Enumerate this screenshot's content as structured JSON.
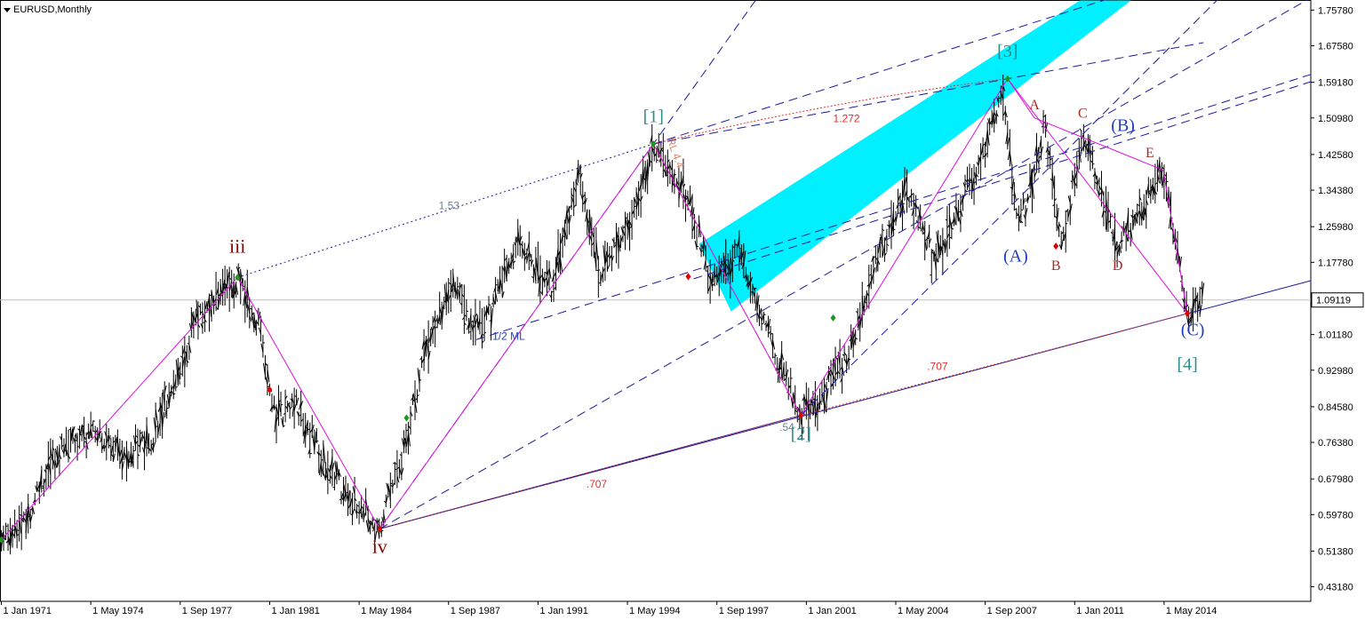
{
  "header": {
    "symbol_label": "EURUSD,Monthly"
  },
  "chart_data": {
    "type": "bar",
    "symbol": "EURUSD",
    "timeframe": "Monthly",
    "ylim": [
      0.3983,
      1.781
    ],
    "y_ticks": [
      "1.75780",
      "1.67580",
      "1.59180",
      "1.50980",
      "1.42580",
      "1.34380",
      "1.25980",
      "1.17780",
      "1.09119",
      "1.01180",
      "0.92980",
      "0.84580",
      "0.76380",
      "0.67980",
      "0.59780",
      "0.51380",
      "0.43180"
    ],
    "current_price": 1.09119,
    "x_ticks": [
      "1 Jan 1971",
      "1 May 1974",
      "1 Sep 1977",
      "1 Jan 1981",
      "1 May 1984",
      "1 Sep 1987",
      "1 Jan 1991",
      "1 May 1994",
      "1 Sep 1997",
      "1 Jan 2001",
      "1 May 2004",
      "1 Sep 2007",
      "1 Jan 2011",
      "1 May 2014"
    ],
    "price_anchors": [
      {
        "t": 1971.0,
        "v": 0.54
      },
      {
        "t": 1972.0,
        "v": 0.6
      },
      {
        "t": 1973.0,
        "v": 0.74
      },
      {
        "t": 1974.5,
        "v": 0.8
      },
      {
        "t": 1975.5,
        "v": 0.74
      },
      {
        "t": 1976.5,
        "v": 0.76
      },
      {
        "t": 1977.5,
        "v": 0.9
      },
      {
        "t": 1978.2,
        "v": 1.04
      },
      {
        "t": 1979.8,
        "v": 1.143
      },
      {
        "t": 1980.6,
        "v": 1.03
      },
      {
        "t": 1981.2,
        "v": 0.82
      },
      {
        "t": 1982.0,
        "v": 0.85
      },
      {
        "t": 1983.0,
        "v": 0.72
      },
      {
        "t": 1984.1,
        "v": 0.62
      },
      {
        "t": 1985.1,
        "v": 0.565
      },
      {
        "t": 1986.0,
        "v": 0.75
      },
      {
        "t": 1987.0,
        "v": 1.02
      },
      {
        "t": 1988.0,
        "v": 1.13
      },
      {
        "t": 1988.6,
        "v": 1.02
      },
      {
        "t": 1989.2,
        "v": 1.06
      },
      {
        "t": 1990.3,
        "v": 1.22
      },
      {
        "t": 1991.5,
        "v": 1.12
      },
      {
        "t": 1992.5,
        "v": 1.38
      },
      {
        "t": 1993.3,
        "v": 1.15
      },
      {
        "t": 1994.5,
        "v": 1.28
      },
      {
        "t": 1995.3,
        "v": 1.45
      },
      {
        "t": 1996.5,
        "v": 1.34
      },
      {
        "t": 1997.5,
        "v": 1.13
      },
      {
        "t": 1998.5,
        "v": 1.2
      },
      {
        "t": 1999.3,
        "v": 1.05
      },
      {
        "t": 2000.3,
        "v": 0.9
      },
      {
        "t": 2000.8,
        "v": 0.826
      },
      {
        "t": 2001.5,
        "v": 0.87
      },
      {
        "t": 2002.5,
        "v": 0.96
      },
      {
        "t": 2003.3,
        "v": 1.13
      },
      {
        "t": 2004.8,
        "v": 1.35
      },
      {
        "t": 2005.8,
        "v": 1.18
      },
      {
        "t": 2006.8,
        "v": 1.31
      },
      {
        "t": 2007.8,
        "v": 1.46
      },
      {
        "t": 2008.3,
        "v": 1.59
      },
      {
        "t": 2008.9,
        "v": 1.25
      },
      {
        "t": 2009.9,
        "v": 1.5
      },
      {
        "t": 2010.5,
        "v": 1.2
      },
      {
        "t": 2011.3,
        "v": 1.48
      },
      {
        "t": 2012.6,
        "v": 1.21
      },
      {
        "t": 2013.5,
        "v": 1.3
      },
      {
        "t": 2014.3,
        "v": 1.39
      },
      {
        "t": 2015.2,
        "v": 1.06
      },
      {
        "t": 2015.8,
        "v": 1.1
      }
    ],
    "wave_points": [
      {
        "t": 1971.0,
        "v": 0.54
      },
      {
        "t": 1979.8,
        "v": 1.143
      },
      {
        "t": 1985.1,
        "v": 0.565
      },
      {
        "t": 1995.3,
        "v": 1.45
      },
      {
        "t": 2000.8,
        "v": 0.826
      },
      {
        "t": 2008.5,
        "v": 1.6
      },
      {
        "t": 2015.2,
        "v": 1.06
      }
    ],
    "correction_points": [
      {
        "t": 2008.5,
        "v": 1.6
      },
      {
        "t": 2009.5,
        "v": 1.51
      },
      {
        "t": 2014.3,
        "v": 1.39
      },
      {
        "t": 2015.2,
        "v": 1.06
      }
    ],
    "wave_labels": [
      {
        "text": "iii",
        "t": 1979.8,
        "v": 1.2,
        "color": "#8b0000",
        "size": 22
      },
      {
        "text": "iv",
        "t": 1985.1,
        "v": 0.51,
        "color": "#8b0000",
        "size": 22
      },
      {
        "text": "[1]",
        "t": 1995.3,
        "v": 1.5,
        "color": "#2e8b8b",
        "size": 20
      },
      {
        "text": "[2]",
        "t": 2000.8,
        "v": 0.77,
        "color": "#2e8b8b",
        "size": 20
      },
      {
        "text": "[3]",
        "t": 2008.5,
        "v": 1.65,
        "color": "#2e8b8b",
        "size": 20
      },
      {
        "text": "[4]",
        "t": 2015.2,
        "v": 0.93,
        "color": "#2e8b8b",
        "size": 20
      },
      {
        "text": "(A)",
        "t": 2008.8,
        "v": 1.18,
        "color": "#1f3fbf",
        "size": 20
      },
      {
        "text": "(B)",
        "t": 2012.8,
        "v": 1.48,
        "color": "#1f3fbf",
        "size": 20
      },
      {
        "text": "(C)",
        "t": 2015.4,
        "v": 1.01,
        "color": "#1f3fbf",
        "size": 20
      },
      {
        "text": "A",
        "t": 2009.5,
        "v": 1.53,
        "color": "#a52a2a",
        "size": 16
      },
      {
        "text": "B",
        "t": 2010.3,
        "v": 1.16,
        "color": "#a52a2a",
        "size": 16
      },
      {
        "text": "C",
        "t": 2011.3,
        "v": 1.51,
        "color": "#a52a2a",
        "size": 16
      },
      {
        "text": "D",
        "t": 2012.6,
        "v": 1.16,
        "color": "#a52a2a",
        "size": 16
      },
      {
        "text": "E",
        "t": 2013.8,
        "v": 1.42,
        "color": "#a52a2a",
        "size": 16
      }
    ],
    "annotations": [
      {
        "text": "1.53",
        "t": 1987.3,
        "v": 1.3,
        "color": "#708090"
      },
      {
        "text": "1.272",
        "t": 2002.0,
        "v": 1.5,
        "color": "#e03030"
      },
      {
        "text": "1/2 ML",
        "t": 1989.3,
        "v": 1.0,
        "color": "#1f3fbf"
      },
      {
        "text": ".707",
        "t": 1992.8,
        "v": 0.66,
        "color": "#e03030"
      },
      {
        "text": ".707",
        "t": 2005.5,
        "v": 0.93,
        "color": "#e03030"
      },
      {
        "text": ".54",
        "t": 2000.0,
        "v": 0.79,
        "color": "#708090"
      },
      {
        "text": "RL 4.4",
        "t": 1995.8,
        "v": 1.46,
        "color": "#e08060"
      }
    ],
    "fractal_points": [
      {
        "t": 1971.0,
        "v": 0.54,
        "color": "#1a9a1a"
      },
      {
        "t": 1979.8,
        "v": 1.143,
        "color": "#1a9a1a"
      },
      {
        "t": 1981.0,
        "v": 0.885,
        "color": "#e00000"
      },
      {
        "t": 1985.1,
        "v": 0.565,
        "color": "#e00000"
      },
      {
        "t": 1986.1,
        "v": 0.82,
        "color": "#1a9a1a"
      },
      {
        "t": 1995.3,
        "v": 1.45,
        "color": "#1a9a1a"
      },
      {
        "t": 1996.6,
        "v": 1.145,
        "color": "#e00000"
      },
      {
        "t": 2000.8,
        "v": 0.826,
        "color": "#e00000"
      },
      {
        "t": 2002.0,
        "v": 1.05,
        "color": "#1a9a1a"
      },
      {
        "t": 2008.5,
        "v": 1.6,
        "color": "#1a9a1a"
      },
      {
        "t": 2010.3,
        "v": 1.215,
        "color": "#e00000"
      },
      {
        "t": 2015.2,
        "v": 1.06,
        "color": "#e00000"
      }
    ]
  }
}
